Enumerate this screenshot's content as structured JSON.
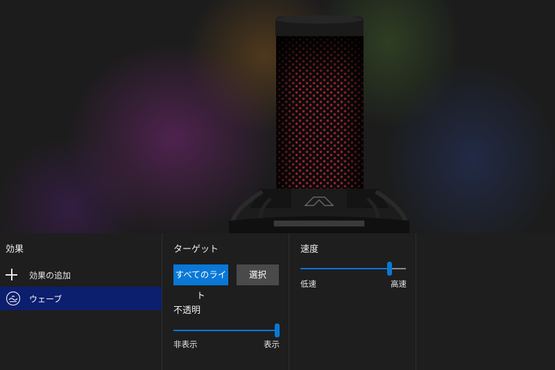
{
  "preview": {
    "image": "hyperx-microphone",
    "logo_icon": "hyperx-logo-icon"
  },
  "effects": {
    "title": "効果",
    "add_label": "効果の追加",
    "items": [
      {
        "label": "ウェーブ",
        "icon": "wave-icon",
        "selected": true
      }
    ]
  },
  "target": {
    "title": "ターゲット",
    "all_lights_label": "すべてのライト",
    "select_label": "選択"
  },
  "opacity": {
    "title": "不透明",
    "min_label": "非表示",
    "max_label": "表示",
    "value_fraction": 1.0
  },
  "speed": {
    "title": "速度",
    "min_label": "低速",
    "max_label": "高速",
    "value_fraction": 0.84
  },
  "colors": {
    "accent": "#0a78d7",
    "selected_item_bg": "#0c1e6e",
    "panel_bg": "#1e1e1e",
    "mic_glow": "#c0303a"
  }
}
